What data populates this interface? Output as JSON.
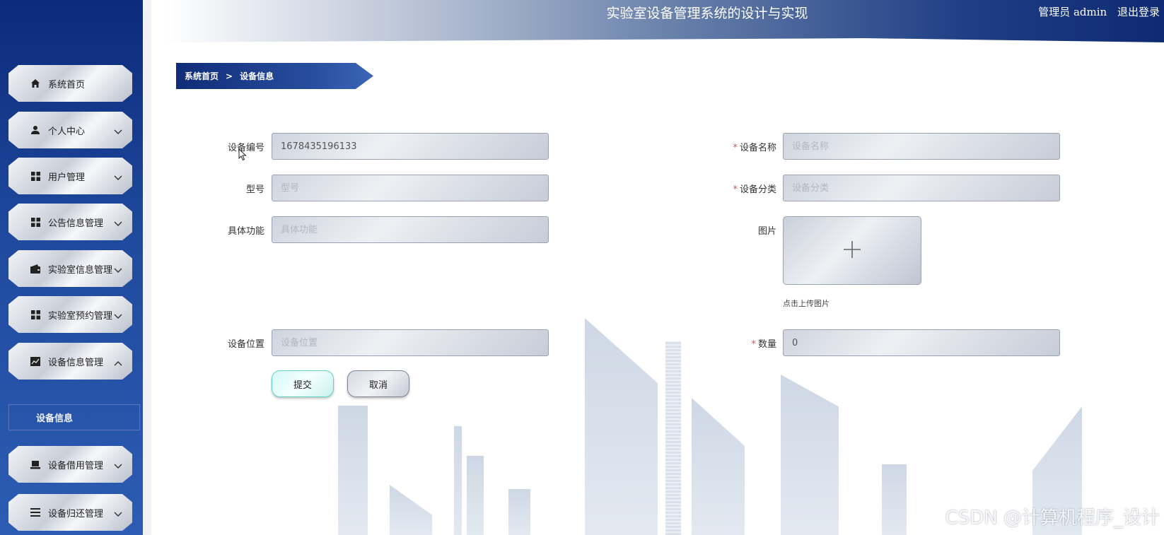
{
  "header": {
    "title": "实验室设备管理系统的设计与实现",
    "user_label": "管理员 admin",
    "logout_label": "退出登录"
  },
  "sidebar": {
    "items": [
      {
        "label": "系统首页",
        "icon": "home-icon",
        "expandable": false
      },
      {
        "label": "个人中心",
        "icon": "user-icon",
        "expandable": true,
        "expanded": false
      },
      {
        "label": "用户管理",
        "icon": "grid-icon",
        "expandable": true,
        "expanded": false
      },
      {
        "label": "公告信息管理",
        "icon": "grid-icon",
        "expandable": true,
        "expanded": false
      },
      {
        "label": "实验室信息管理",
        "icon": "wallet-icon",
        "expandable": true,
        "expanded": false
      },
      {
        "label": "实验室预约管理",
        "icon": "grid-icon",
        "expandable": true,
        "expanded": false
      },
      {
        "label": "设备信息管理",
        "icon": "chart-icon",
        "expandable": true,
        "expanded": true
      },
      {
        "label": "设备借用管理",
        "icon": "laptop-icon",
        "expandable": true,
        "expanded": false
      },
      {
        "label": "设备归还管理",
        "icon": "list-icon",
        "expandable": true,
        "expanded": false
      }
    ],
    "subitem": "设备信息"
  },
  "breadcrumb": {
    "home": "系统首页",
    "separator": ">",
    "current": "设备信息"
  },
  "form": {
    "device_no": {
      "label": "设备编号",
      "value": "1678435196133",
      "required": false
    },
    "device_name": {
      "label": "设备名称",
      "placeholder": "设备名称",
      "required": true
    },
    "model": {
      "label": "型号",
      "placeholder": "型号",
      "required": false
    },
    "category": {
      "label": "设备分类",
      "placeholder": "设备分类",
      "required": true
    },
    "function": {
      "label": "具体功能",
      "placeholder": "具体功能",
      "required": false
    },
    "image": {
      "label": "图片",
      "tip": "点击上传图片"
    },
    "location": {
      "label": "设备位置",
      "placeholder": "设备位置",
      "required": false
    },
    "quantity": {
      "label": "数量",
      "value": "0",
      "required": true
    },
    "required_mark": "*",
    "submit_label": "提交",
    "cancel_label": "取消"
  },
  "watermark": "CSDN @计算机程序_设计",
  "colors": {
    "sidebar_top": "#0c2a7a",
    "sidebar_bottom": "#2c5cb3",
    "required": "#d9534f",
    "submit_border": "#5fd3c6"
  }
}
